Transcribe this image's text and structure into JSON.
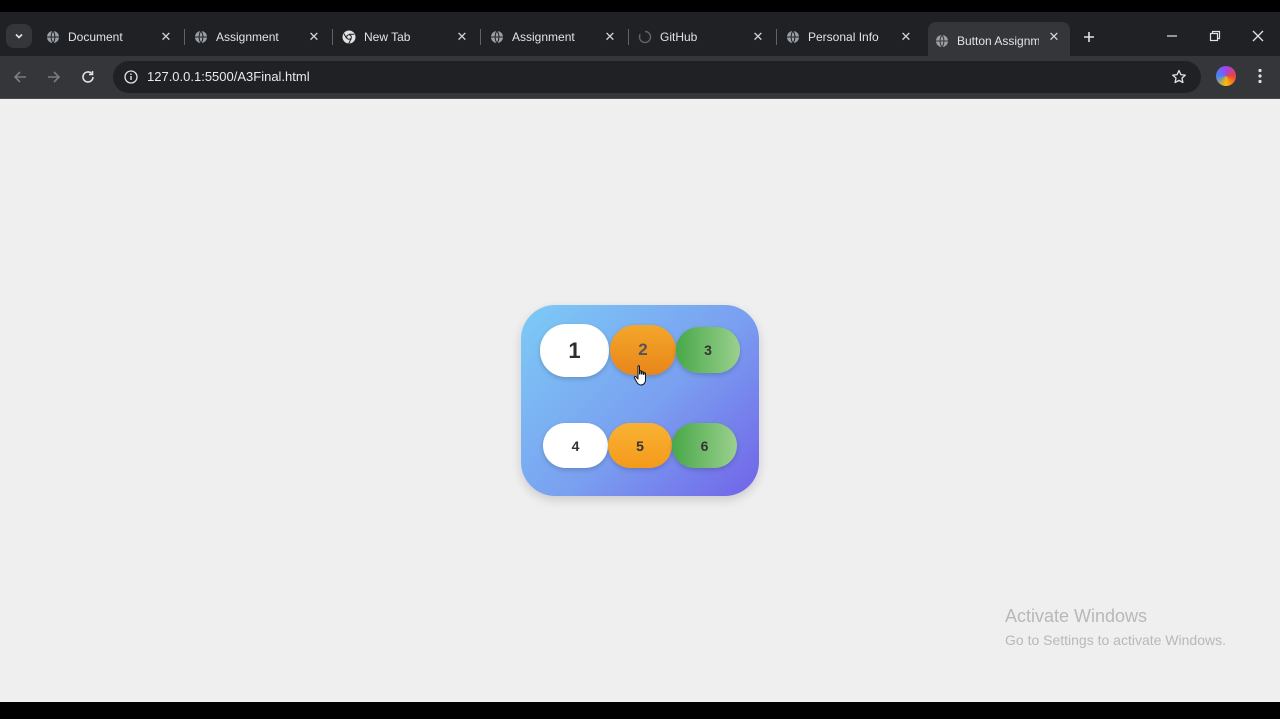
{
  "tabs": [
    {
      "title": "Document",
      "icon": "globe-icon",
      "active": false
    },
    {
      "title": "Assignment",
      "icon": "globe-icon",
      "active": false
    },
    {
      "title": "New Tab",
      "icon": "chrome-icon",
      "active": false
    },
    {
      "title": "Assignment",
      "icon": "globe-icon",
      "active": false
    },
    {
      "title": "GitHub",
      "icon": "loading-spinner-icon",
      "active": false
    },
    {
      "title": "Personal Info",
      "icon": "globe-icon",
      "active": false
    },
    {
      "title": "Button Assignme",
      "icon": "globe-icon",
      "active": true
    }
  ],
  "address_bar": {
    "url": "127.0.0.1:5500/A3Final.html"
  },
  "page": {
    "background": "#efefef",
    "card_gradient": [
      "#7ccbf6",
      "#7163e8"
    ],
    "buttons": [
      {
        "label": "1",
        "color": "white"
      },
      {
        "label": "2",
        "color": "orange"
      },
      {
        "label": "3",
        "color": "green"
      },
      {
        "label": "4",
        "color": "white"
      },
      {
        "label": "5",
        "color": "orange"
      },
      {
        "label": "6",
        "color": "green"
      }
    ]
  },
  "watermark": {
    "title": "Activate Windows",
    "subtitle": "Go to Settings to activate Windows."
  }
}
